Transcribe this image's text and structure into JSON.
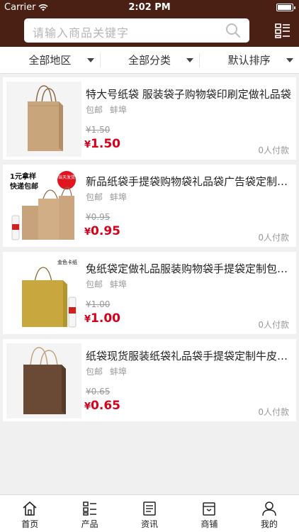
{
  "status": {
    "carrier": "Carrier",
    "time": "2:02 PM"
  },
  "header": {
    "search_placeholder": "请输入商品关键字"
  },
  "filters": [
    {
      "label": "全部地区"
    },
    {
      "label": "全部分类"
    },
    {
      "label": "默认排序"
    }
  ],
  "products": [
    {
      "title": "特大号纸袋 服装袋子购物袋印刷定做礼品袋",
      "shipping": "包邮",
      "location": "蚌埠",
      "original_price": "¥1.50",
      "price_symbol": "¥",
      "price": "1.50",
      "sold": "0人付款"
    },
    {
      "title": "新品纸袋手提袋购物袋礼品袋广告袋定制印刷",
      "shipping": "包邮",
      "location": "蚌埠",
      "original_price": "¥0.95",
      "price_symbol": "¥",
      "price": "0.95",
      "sold": "0人付款",
      "image_text": {
        "line1": "1元拿样",
        "line2": "快递包邮",
        "badge": "当天发货"
      }
    },
    {
      "title": "兔纸袋定做礼品服装购物袋手提袋定制包装袋",
      "shipping": "包邮",
      "location": "蚌埠",
      "original_price": "¥1.00",
      "price_symbol": "¥",
      "price": "1.00",
      "sold": "0人付款",
      "image_text": {
        "tag": "金色卡纸"
      }
    },
    {
      "title": "纸袋现货服装纸袋礼品袋手提袋定制牛皮纸袋",
      "shipping": "包邮",
      "location": "蚌埠",
      "original_price": "¥0.65",
      "price_symbol": "¥",
      "price": "0.65",
      "sold": "0人付款"
    }
  ],
  "tabbar": [
    {
      "label": "首页",
      "icon": "home-icon"
    },
    {
      "label": "产品",
      "icon": "product-list-icon"
    },
    {
      "label": "资讯",
      "icon": "news-icon"
    },
    {
      "label": "商铺",
      "icon": "store-icon"
    },
    {
      "label": "我的",
      "icon": "user-icon"
    }
  ],
  "colors": {
    "header_bg": "#4a1f14",
    "price": "#d6001c",
    "page_bg": "#f0f0f0"
  }
}
